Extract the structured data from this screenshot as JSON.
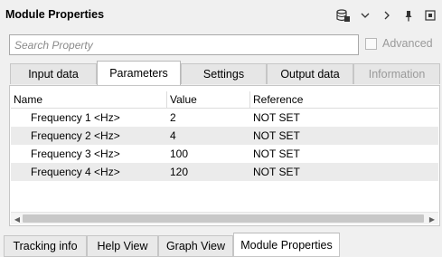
{
  "window": {
    "title": "Module Properties"
  },
  "toolbar_icons": [
    "database-icon",
    "chevron-down-icon",
    "chevron-right-icon",
    "pin-icon",
    "popout-icon"
  ],
  "search": {
    "placeholder": "Search Property"
  },
  "advanced": {
    "label": "Advanced",
    "checked": false
  },
  "tabs": [
    {
      "label": "Input data",
      "active": false,
      "enabled": true
    },
    {
      "label": "Parameters",
      "active": true,
      "enabled": true
    },
    {
      "label": "Settings",
      "active": false,
      "enabled": true
    },
    {
      "label": "Output data",
      "active": false,
      "enabled": true
    },
    {
      "label": "Information",
      "active": false,
      "enabled": false
    }
  ],
  "table": {
    "columns": [
      "Name",
      "Value",
      "Reference"
    ],
    "rows": [
      {
        "name": "Frequency 1 <Hz>",
        "value": "2",
        "reference": "NOT SET"
      },
      {
        "name": "Frequency 2 <Hz>",
        "value": "4",
        "reference": "NOT SET"
      },
      {
        "name": "Frequency 3 <Hz>",
        "value": "100",
        "reference": "NOT SET"
      },
      {
        "name": "Frequency 4 <Hz>",
        "value": "120",
        "reference": "NOT SET"
      }
    ]
  },
  "bottom_tabs": [
    {
      "label": "Tracking info",
      "active": false
    },
    {
      "label": "Help View",
      "active": false
    },
    {
      "label": "Graph View",
      "active": false
    },
    {
      "label": "Module Properties",
      "active": true
    }
  ]
}
